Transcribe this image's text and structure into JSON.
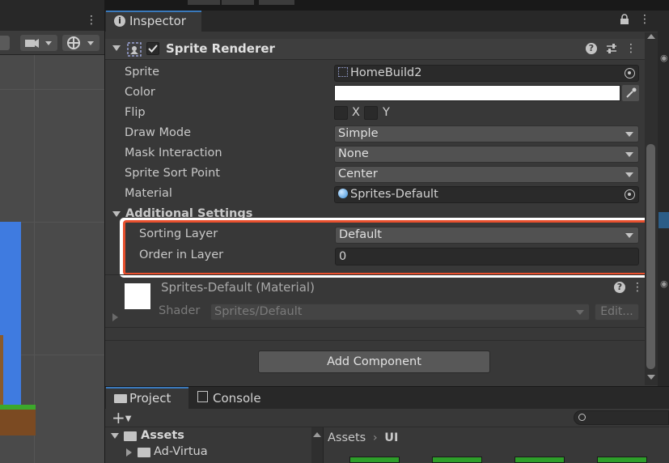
{
  "inspector": {
    "tab_label": "Inspector",
    "component": {
      "title": "Sprite Renderer",
      "fields": {
        "sprite_label": "Sprite",
        "sprite_value": "HomeBuild2",
        "color_label": "Color",
        "flip_label": "Flip",
        "flip_x": "X",
        "flip_y": "Y",
        "draw_mode_label": "Draw Mode",
        "draw_mode_value": "Simple",
        "mask_label": "Mask Interaction",
        "mask_value": "None",
        "sort_point_label": "Sprite Sort Point",
        "sort_point_value": "Center",
        "material_label": "Material",
        "material_value": "Sprites-Default"
      },
      "additional_settings": {
        "title": "Additional Settings",
        "sorting_layer_label": "Sorting Layer",
        "sorting_layer_value": "Default",
        "order_label": "Order in Layer",
        "order_value": "0"
      }
    },
    "material_section": {
      "title": "Sprites-Default (Material)",
      "shader_label": "Shader",
      "shader_value": "Sprites/Default",
      "edit_label": "Edit..."
    },
    "add_component_label": "Add Component"
  },
  "project": {
    "tab_project": "Project",
    "tab_console": "Console",
    "tree_assets": "Assets",
    "tree_child": "Ad-Virtua",
    "breadcrumb_root": "Assets",
    "breadcrumb_current": "UI"
  },
  "colors": {
    "highlight_border": "#e8502e",
    "accent_blue": "#3a79bb",
    "panel_bg": "#383838"
  }
}
